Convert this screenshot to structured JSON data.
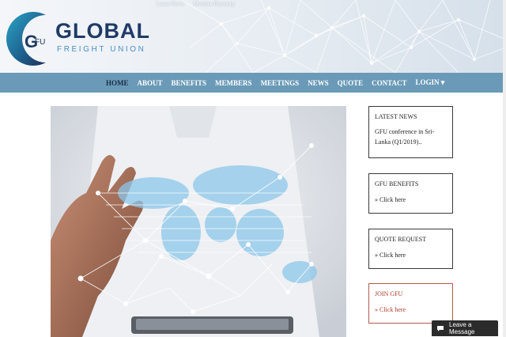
{
  "header": {
    "top_links": [
      "Latest News",
      "Member Directory"
    ],
    "logo": {
      "badge": "FU",
      "badge_g": "G",
      "title": "GLOBAL",
      "subtitle": "FREIGHT UNION"
    }
  },
  "nav": {
    "items": [
      "HOME",
      "ABOUT",
      "BENEFITS",
      "MEMBERS",
      "MEETINGS",
      "NEWS",
      "QUOTE",
      "CONTACT",
      "LOGIN ▾"
    ],
    "active_index": 0
  },
  "sidebar": {
    "latest_news": {
      "title": "LATEST NEWS",
      "text": "GFU conference in Sri-Lanka (Q1/2019).."
    },
    "benefits": {
      "title": "GFU BENEFITS",
      "link": "» Click here"
    },
    "quote": {
      "title": "QUOTE REQUEST",
      "link": "» Click here"
    },
    "join": {
      "title": "JOIN GFU",
      "link": "» Click here"
    }
  },
  "chat": {
    "label": "Leave a Message"
  },
  "colors": {
    "nav": "#6a9ab7",
    "logo_dark": "#1f3a66",
    "logo_light": "#4a8fc4",
    "join_red": "#b03b2b"
  }
}
